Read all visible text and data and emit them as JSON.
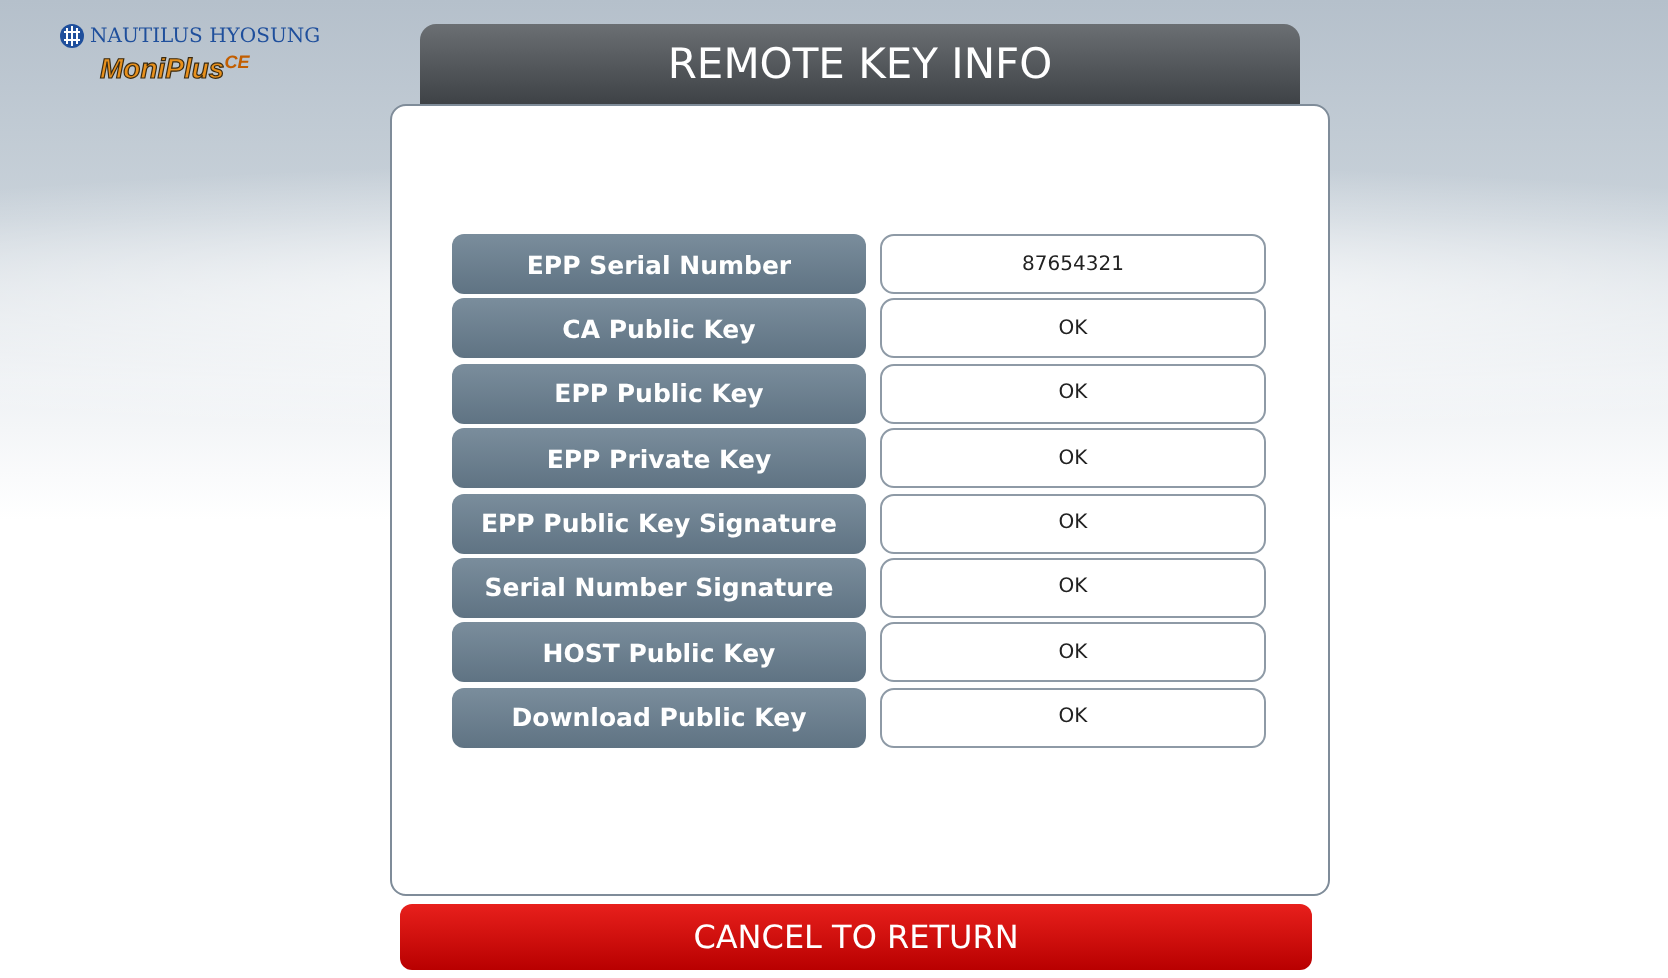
{
  "logo": {
    "company": "NAUTILUS HYOSUNG",
    "product": "MoniPlus",
    "edition": "CE"
  },
  "title": "REMOTE KEY INFO",
  "rows": [
    {
      "label": "EPP Serial Number",
      "value": "87654321"
    },
    {
      "label": "CA Public Key",
      "value": "OK"
    },
    {
      "label": "EPP Public Key",
      "value": "OK"
    },
    {
      "label": "EPP Private Key",
      "value": "OK"
    },
    {
      "label": "EPP Public Key Signature",
      "value": "OK"
    },
    {
      "label": "Serial Number Signature",
      "value": "OK"
    },
    {
      "label": "HOST Public Key",
      "value": "OK"
    },
    {
      "label": "Download Public Key",
      "value": "OK"
    }
  ],
  "cancel_button": "CANCEL TO RETURN"
}
